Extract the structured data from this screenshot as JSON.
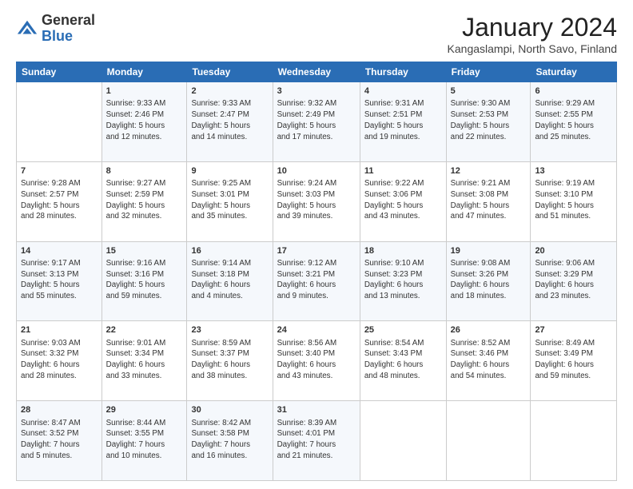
{
  "header": {
    "logo_general": "General",
    "logo_blue": "Blue",
    "month_title": "January 2024",
    "subtitle": "Kangaslampi, North Savo, Finland"
  },
  "days_of_week": [
    "Sunday",
    "Monday",
    "Tuesday",
    "Wednesday",
    "Thursday",
    "Friday",
    "Saturday"
  ],
  "weeks": [
    [
      {
        "day": "",
        "info": ""
      },
      {
        "day": "1",
        "info": "Sunrise: 9:33 AM\nSunset: 2:46 PM\nDaylight: 5 hours\nand 12 minutes."
      },
      {
        "day": "2",
        "info": "Sunrise: 9:33 AM\nSunset: 2:47 PM\nDaylight: 5 hours\nand 14 minutes."
      },
      {
        "day": "3",
        "info": "Sunrise: 9:32 AM\nSunset: 2:49 PM\nDaylight: 5 hours\nand 17 minutes."
      },
      {
        "day": "4",
        "info": "Sunrise: 9:31 AM\nSunset: 2:51 PM\nDaylight: 5 hours\nand 19 minutes."
      },
      {
        "day": "5",
        "info": "Sunrise: 9:30 AM\nSunset: 2:53 PM\nDaylight: 5 hours\nand 22 minutes."
      },
      {
        "day": "6",
        "info": "Sunrise: 9:29 AM\nSunset: 2:55 PM\nDaylight: 5 hours\nand 25 minutes."
      }
    ],
    [
      {
        "day": "7",
        "info": "Sunrise: 9:28 AM\nSunset: 2:57 PM\nDaylight: 5 hours\nand 28 minutes."
      },
      {
        "day": "8",
        "info": "Sunrise: 9:27 AM\nSunset: 2:59 PM\nDaylight: 5 hours\nand 32 minutes."
      },
      {
        "day": "9",
        "info": "Sunrise: 9:25 AM\nSunset: 3:01 PM\nDaylight: 5 hours\nand 35 minutes."
      },
      {
        "day": "10",
        "info": "Sunrise: 9:24 AM\nSunset: 3:03 PM\nDaylight: 5 hours\nand 39 minutes."
      },
      {
        "day": "11",
        "info": "Sunrise: 9:22 AM\nSunset: 3:06 PM\nDaylight: 5 hours\nand 43 minutes."
      },
      {
        "day": "12",
        "info": "Sunrise: 9:21 AM\nSunset: 3:08 PM\nDaylight: 5 hours\nand 47 minutes."
      },
      {
        "day": "13",
        "info": "Sunrise: 9:19 AM\nSunset: 3:10 PM\nDaylight: 5 hours\nand 51 minutes."
      }
    ],
    [
      {
        "day": "14",
        "info": "Sunrise: 9:17 AM\nSunset: 3:13 PM\nDaylight: 5 hours\nand 55 minutes."
      },
      {
        "day": "15",
        "info": "Sunrise: 9:16 AM\nSunset: 3:16 PM\nDaylight: 5 hours\nand 59 minutes."
      },
      {
        "day": "16",
        "info": "Sunrise: 9:14 AM\nSunset: 3:18 PM\nDaylight: 6 hours\nand 4 minutes."
      },
      {
        "day": "17",
        "info": "Sunrise: 9:12 AM\nSunset: 3:21 PM\nDaylight: 6 hours\nand 9 minutes."
      },
      {
        "day": "18",
        "info": "Sunrise: 9:10 AM\nSunset: 3:23 PM\nDaylight: 6 hours\nand 13 minutes."
      },
      {
        "day": "19",
        "info": "Sunrise: 9:08 AM\nSunset: 3:26 PM\nDaylight: 6 hours\nand 18 minutes."
      },
      {
        "day": "20",
        "info": "Sunrise: 9:06 AM\nSunset: 3:29 PM\nDaylight: 6 hours\nand 23 minutes."
      }
    ],
    [
      {
        "day": "21",
        "info": "Sunrise: 9:03 AM\nSunset: 3:32 PM\nDaylight: 6 hours\nand 28 minutes."
      },
      {
        "day": "22",
        "info": "Sunrise: 9:01 AM\nSunset: 3:34 PM\nDaylight: 6 hours\nand 33 minutes."
      },
      {
        "day": "23",
        "info": "Sunrise: 8:59 AM\nSunset: 3:37 PM\nDaylight: 6 hours\nand 38 minutes."
      },
      {
        "day": "24",
        "info": "Sunrise: 8:56 AM\nSunset: 3:40 PM\nDaylight: 6 hours\nand 43 minutes."
      },
      {
        "day": "25",
        "info": "Sunrise: 8:54 AM\nSunset: 3:43 PM\nDaylight: 6 hours\nand 48 minutes."
      },
      {
        "day": "26",
        "info": "Sunrise: 8:52 AM\nSunset: 3:46 PM\nDaylight: 6 hours\nand 54 minutes."
      },
      {
        "day": "27",
        "info": "Sunrise: 8:49 AM\nSunset: 3:49 PM\nDaylight: 6 hours\nand 59 minutes."
      }
    ],
    [
      {
        "day": "28",
        "info": "Sunrise: 8:47 AM\nSunset: 3:52 PM\nDaylight: 7 hours\nand 5 minutes."
      },
      {
        "day": "29",
        "info": "Sunrise: 8:44 AM\nSunset: 3:55 PM\nDaylight: 7 hours\nand 10 minutes."
      },
      {
        "day": "30",
        "info": "Sunrise: 8:42 AM\nSunset: 3:58 PM\nDaylight: 7 hours\nand 16 minutes."
      },
      {
        "day": "31",
        "info": "Sunrise: 8:39 AM\nSunset: 4:01 PM\nDaylight: 7 hours\nand 21 minutes."
      },
      {
        "day": "",
        "info": ""
      },
      {
        "day": "",
        "info": ""
      },
      {
        "day": "",
        "info": ""
      }
    ]
  ]
}
